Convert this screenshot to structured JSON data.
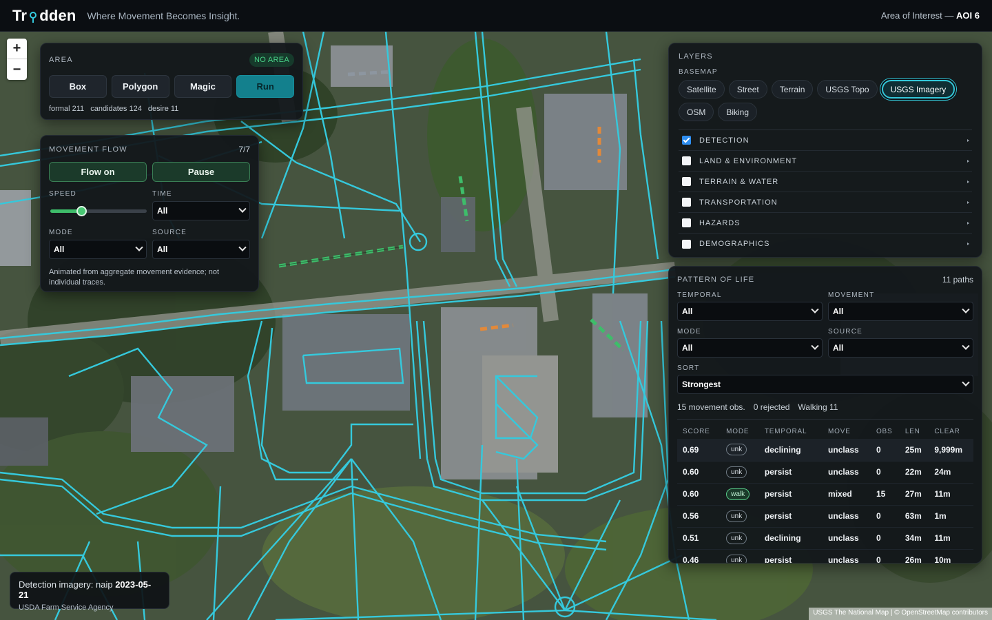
{
  "header": {
    "logo_left": "Tr",
    "logo_right": "dden",
    "tagline": "Where Movement Becomes Insight.",
    "aoi_label": "Area of Interest —",
    "aoi_value": "AOI 6"
  },
  "zoom": {
    "in": "+",
    "out": "−"
  },
  "area": {
    "caption": "AREA",
    "badge": "NO AREA",
    "buttons": [
      "Box",
      "Polygon",
      "Magic",
      "Run"
    ],
    "stats": [
      "formal 211",
      "candidates 124",
      "desire 11"
    ]
  },
  "flow": {
    "caption": "MOVEMENT FLOW",
    "count": "7/7",
    "flow_on": "Flow on",
    "pause": "Pause",
    "speed_label": "SPEED",
    "speed_value": 0.33,
    "time_label": "TIME",
    "time_value": "All",
    "mode_label": "MODE",
    "mode_value": "All",
    "source_label": "SOURCE",
    "source_value": "All",
    "note": "Animated from aggregate movement evidence; not individual traces."
  },
  "layers": {
    "caption": "LAYERS",
    "basemap_caption": "BASEMAP",
    "basemaps": [
      "Satellite",
      "Street",
      "Terrain",
      "USGS Topo",
      "USGS Imagery",
      "OSM",
      "Biking"
    ],
    "active_basemap": "USGS Imagery",
    "groups": [
      {
        "label": "DETECTION",
        "checked": true
      },
      {
        "label": "LAND & ENVIRONMENT",
        "checked": false
      },
      {
        "label": "TERRAIN & WATER",
        "checked": false
      },
      {
        "label": "TRANSPORTATION",
        "checked": false
      },
      {
        "label": "HAZARDS",
        "checked": false
      },
      {
        "label": "DEMOGRAPHICS",
        "checked": false
      }
    ]
  },
  "pattern": {
    "caption": "PATTERN OF LIFE",
    "paths": "11 paths",
    "temporal_label": "TEMPORAL",
    "temporal_value": "All",
    "movement_label": "MOVEMENT",
    "movement_value": "All",
    "mode_label": "MODE",
    "mode_value": "All",
    "source_label": "SOURCE",
    "source_value": "All",
    "sort_label": "SORT",
    "sort_value": "Strongest",
    "summary": [
      "15 movement obs.",
      "0 rejected",
      "Walking 11"
    ],
    "columns": [
      "SCORE",
      "MODE",
      "TEMPORAL",
      "MOVE",
      "OBS",
      "LEN",
      "CLEAR"
    ],
    "rows": [
      [
        "0.69",
        "unk",
        "declining",
        "unclass",
        "0",
        "25m",
        "9,999m"
      ],
      [
        "0.60",
        "unk",
        "persist",
        "unclass",
        "0",
        "22m",
        "24m"
      ],
      [
        "0.60",
        "walk",
        "persist",
        "mixed",
        "15",
        "27m",
        "11m"
      ],
      [
        "0.56",
        "unk",
        "persist",
        "unclass",
        "0",
        "63m",
        "1m"
      ],
      [
        "0.51",
        "unk",
        "declining",
        "unclass",
        "0",
        "34m",
        "11m"
      ],
      [
        "0.46",
        "unk",
        "persist",
        "unclass",
        "0",
        "26m",
        "10m"
      ]
    ]
  },
  "imagery": {
    "line1": "Detection imagery: naip",
    "date": "2023-05-21",
    "line2": "USDA Farm Service Agency"
  },
  "attribution": "USGS The National Map | © OpenStreetMap contributors",
  "colors": {
    "path_line": "#35c9dc",
    "accent_green": "#3ebd6a",
    "run_button": "#13808d"
  }
}
